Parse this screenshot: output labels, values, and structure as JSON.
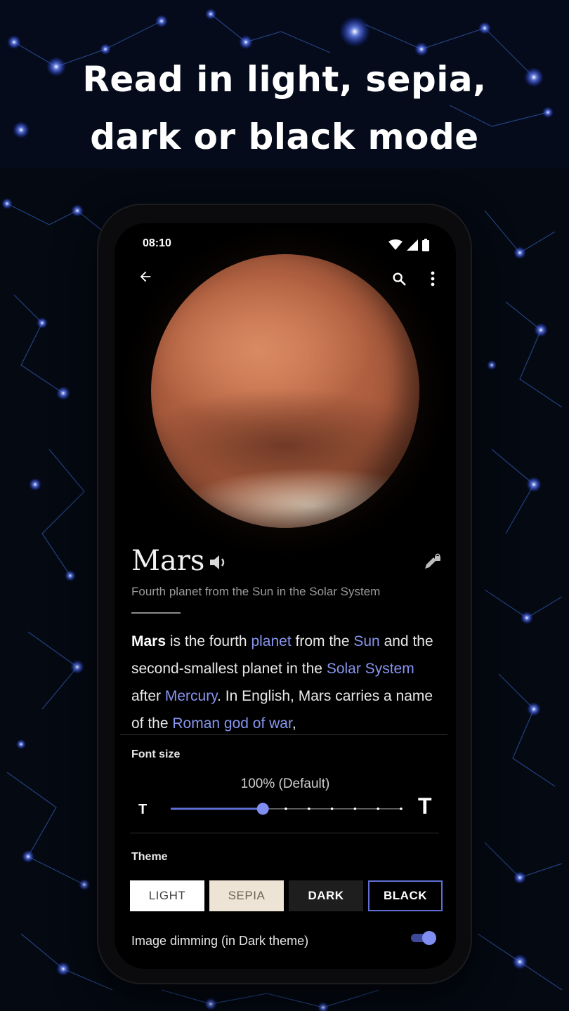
{
  "headline": {
    "line1": "Read in light, sepia,",
    "line2": "dark or black mode"
  },
  "status_bar": {
    "time": "08:10"
  },
  "article": {
    "title": "Mars",
    "description": "Fourth planet from the Sun in the Solar System",
    "body": [
      {
        "text": "Mars",
        "style": "bold"
      },
      {
        "text": " is the fourth ",
        "style": "plain"
      },
      {
        "text": "planet",
        "style": "link"
      },
      {
        "text": " from the ",
        "style": "plain"
      },
      {
        "text": "Sun",
        "style": "link"
      },
      {
        "text": " and the second-smallest planet in the ",
        "style": "plain"
      },
      {
        "text": "Solar System",
        "style": "link"
      },
      {
        "text": " after ",
        "style": "plain"
      },
      {
        "text": "Mercury",
        "style": "link"
      },
      {
        "text": ". In English, Mars carries a name of the ",
        "style": "plain"
      },
      {
        "text": "Roman god of war",
        "style": "link"
      },
      {
        "text": ",",
        "style": "plain"
      }
    ]
  },
  "settings": {
    "font_size_label": "Font size",
    "font_size_value": "100% (Default)",
    "font_size_small_glyph": "T",
    "font_size_large_glyph": "T",
    "font_size_slider": {
      "steps": 11,
      "selected_index": 4
    },
    "theme_label": "Theme",
    "themes": [
      {
        "label": "LIGHT",
        "selected": false
      },
      {
        "label": "SEPIA",
        "selected": false
      },
      {
        "label": "DARK",
        "selected": false
      },
      {
        "label": "BLACK",
        "selected": true
      }
    ],
    "image_dimming_label": "Image dimming (in Dark theme)",
    "image_dimming_on": true
  },
  "colors": {
    "accent": "#5f6fd6",
    "link": "#8795ef",
    "background": "#050b1a"
  },
  "icons": {
    "back": "arrow-left-icon",
    "search": "search-icon",
    "overflow": "more-vertical-icon",
    "speaker": "speaker-icon",
    "edit": "pencil-lock-icon"
  }
}
